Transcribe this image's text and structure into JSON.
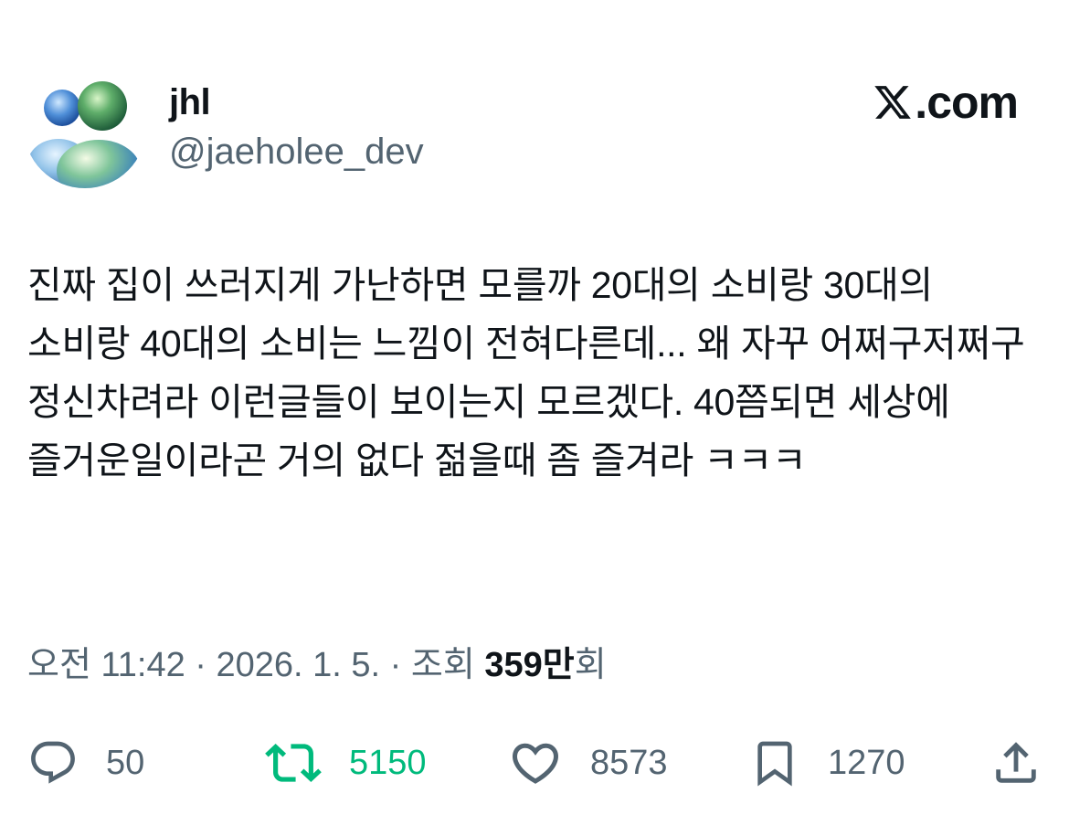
{
  "profile": {
    "name": "jhl",
    "handle": "@jaeholee_dev",
    "avatar_icon": "two-person-avatar-icon"
  },
  "brand": {
    "label": ".com",
    "icon": "x-logo-icon"
  },
  "tweet": {
    "text": "진짜 집이 쓰러지게 가난하면 모를까 20대의 소비랑 30대의 소비랑 40대의 소비는 느낌이 전혀다른데... 왜 자꾸 어쩌구저쩌구 정신차려라 이런글들이 보이는지 모르겠다. 40쯤되면 세상에 즐거운일이라곤 거의 없다 젊을때 좀 즐겨라 ㅋㅋㅋ"
  },
  "meta": {
    "prefix": "오전 11:42 · 2026. 1. 5. · 조회 ",
    "views": "359만",
    "suffix": "회"
  },
  "actions": {
    "replies": "50",
    "retweets": "5150",
    "likes": "8573",
    "bookmarks": "1270"
  },
  "colors": {
    "text": "#0f1419",
    "secondary": "#536471",
    "retweet_green": "#00ba7c"
  }
}
